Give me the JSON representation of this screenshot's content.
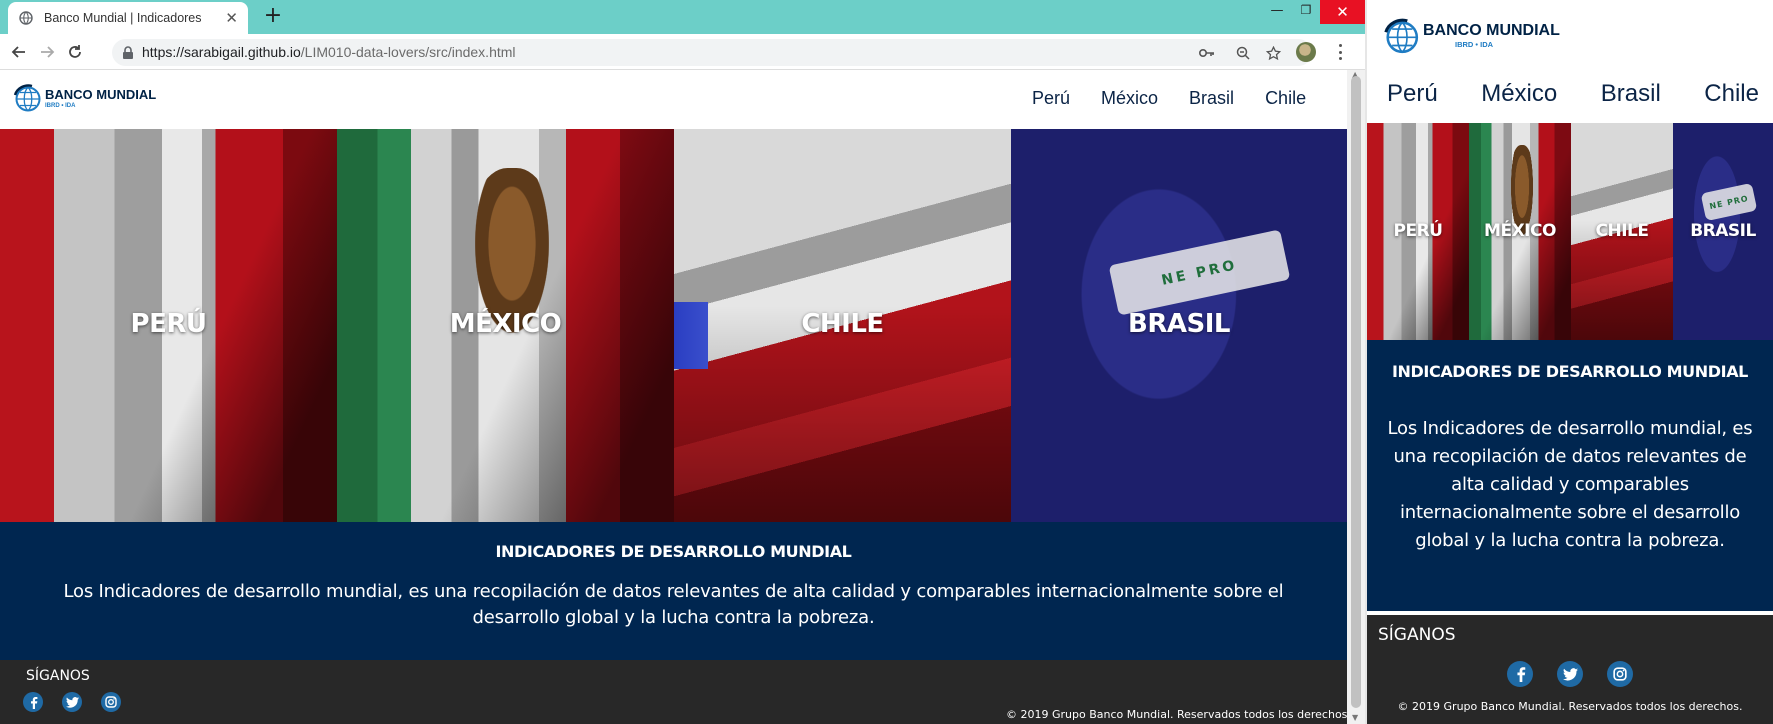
{
  "browser": {
    "tab_title": "Banco Mundial | Indicadores",
    "url_host": "https://sarabigail.github.io",
    "url_path": "/LIM010-data-lovers/src/index.html",
    "min_glyph": "—",
    "max_glyph": "❐",
    "close_glyph": "✕",
    "new_tab_glyph": "+"
  },
  "logo": {
    "brand": "BANCO  MUNDIAL",
    "sub": "IBRD • IDA"
  },
  "nav": [
    "Perú",
    "México",
    "Brasil",
    "Chile"
  ],
  "flags": [
    "PERÚ",
    "MÉXICO",
    "CHILE",
    "BRASIL"
  ],
  "flags_mobile": [
    "PERÚ",
    "MÉXICO",
    "CHILE",
    "BRASIL"
  ],
  "brasil_band": "NE PRO",
  "info": {
    "title": "INDICADORES DE DESARROLLO MUNDIAL",
    "desc": "Los Indicadores de desarrollo mundial, es una recopilación de datos relevantes de alta calidad y comparables internacionalmente sobre el desarrollo global y la lucha contra la pobreza."
  },
  "footer": {
    "follow": "SÍGANOS",
    "copyright": "© 2019 Grupo Banco Mundial. Reservados todos los derechos.",
    "social": [
      "facebook-icon",
      "twitter-icon",
      "instagram-icon"
    ]
  },
  "colors": {
    "tabbar": "#6ccfc8",
    "navy": "#002650",
    "footer": "#282828",
    "social": "#1f6aa5"
  }
}
